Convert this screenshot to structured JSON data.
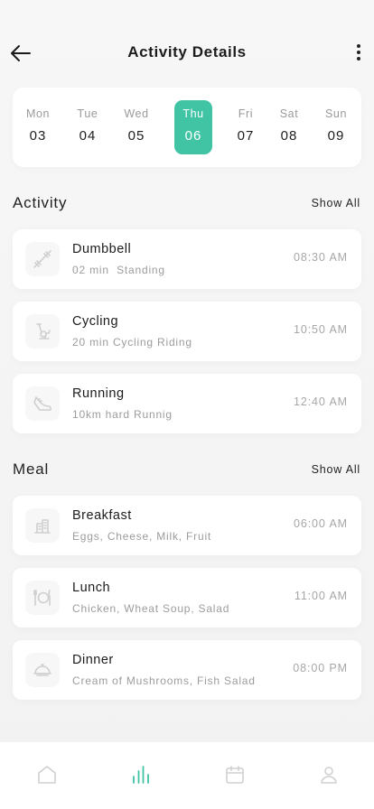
{
  "header": {
    "title": "Activity Details",
    "back_icon": "arrow-left-icon",
    "more_icon": "more-vertical-icon"
  },
  "calendar": {
    "days": [
      {
        "name": "Mon",
        "date": "03"
      },
      {
        "name": "Tue",
        "date": "04"
      },
      {
        "name": "Wed",
        "date": "05"
      },
      {
        "name": "Thu",
        "date": "06"
      },
      {
        "name": "Fri",
        "date": "07"
      },
      {
        "name": "Sat",
        "date": "08"
      },
      {
        "name": "Sun",
        "date": "09"
      }
    ],
    "selected_day": "Thu",
    "accent_color": "#40c4a4"
  },
  "activity": {
    "title": "Activity",
    "show_all": "Show All",
    "items": [
      {
        "name": "Dumbbell",
        "detail": "02 min  Standing",
        "time": "08:30 AM",
        "icon": "dumbbell-icon"
      },
      {
        "name": "Cycling",
        "detail": "20 min Cycling Riding",
        "time": "10:50 AM",
        "icon": "exercise-bike-icon"
      },
      {
        "name": "Running",
        "detail": "10km hard Runnig",
        "time": "12:40 AM",
        "icon": "running-shoe-icon"
      }
    ]
  },
  "meal": {
    "title": "Meal",
    "show_all": "Show All",
    "items": [
      {
        "name": "Breakfast",
        "detail": "Eggs, Cheese, Milk, Fruit",
        "time": "06:00 AM",
        "icon": "breakfast-icon"
      },
      {
        "name": "Lunch",
        "detail": "Chicken, Wheat Soup, Salad",
        "time": "11:00 AM",
        "icon": "plate-cutlery-icon"
      },
      {
        "name": "Dinner",
        "detail": "Cream of Mushrooms, Fish Salad",
        "time": "08:00 PM",
        "icon": "cloche-icon"
      }
    ]
  },
  "tabbar": {
    "tabs": [
      "home-icon",
      "stats-icon",
      "calendar-icon",
      "profile-icon"
    ],
    "active_tab": "stats-icon"
  }
}
